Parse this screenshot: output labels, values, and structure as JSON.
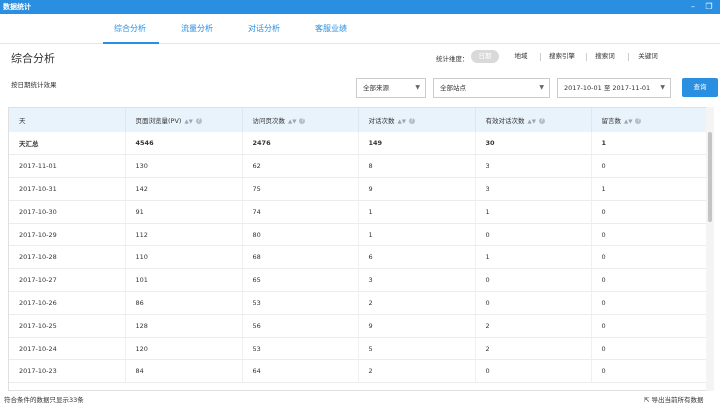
{
  "window": {
    "title": "数据统计",
    "minimize_icon": "minimize-icon",
    "restore_icon": "restore-icon"
  },
  "tabs": [
    {
      "label": "综合分析",
      "active": true
    },
    {
      "label": "流量分析",
      "active": false
    },
    {
      "label": "对话分析",
      "active": false
    },
    {
      "label": "客服业绩",
      "active": false
    }
  ],
  "page": {
    "title": "综合分析",
    "subtitle": "按日期统计效果"
  },
  "dimension": {
    "label": "统计维度：",
    "options": [
      "日期",
      "地域",
      "搜索引擎",
      "搜索词",
      "关键词"
    ],
    "active": "日期"
  },
  "filters": {
    "source": "全部来源",
    "site": "全部站点",
    "date_range": "2017-10-01 至 2017-11-01",
    "query_label": "查询"
  },
  "table": {
    "columns": [
      "天",
      "页面浏览量(PV)",
      "访问页次数",
      "对话次数",
      "有效对话次数",
      "留言数"
    ],
    "summary": [
      "天汇总",
      "4546",
      "2476",
      "149",
      "30",
      "1"
    ],
    "rows": [
      [
        "2017-11-01",
        "130",
        "62",
        "8",
        "3",
        "0"
      ],
      [
        "2017-10-31",
        "142",
        "75",
        "9",
        "3",
        "1"
      ],
      [
        "2017-10-30",
        "91",
        "74",
        "1",
        "1",
        "0"
      ],
      [
        "2017-10-29",
        "112",
        "80",
        "1",
        "0",
        "0"
      ],
      [
        "2017-10-28",
        "110",
        "68",
        "6",
        "1",
        "0"
      ],
      [
        "2017-10-27",
        "101",
        "65",
        "3",
        "0",
        "0"
      ],
      [
        "2017-10-26",
        "86",
        "53",
        "2",
        "0",
        "0"
      ],
      [
        "2017-10-25",
        "128",
        "56",
        "9",
        "2",
        "0"
      ],
      [
        "2017-10-24",
        "120",
        "53",
        "5",
        "2",
        "0"
      ],
      [
        "2017-10-23",
        "84",
        "64",
        "2",
        "0",
        "0"
      ]
    ]
  },
  "footer": {
    "count_text": "符合条件的数据只显示33条",
    "export_label": "导出当前所有数据"
  },
  "colors": {
    "accent": "#2a8fe0",
    "header_bg": "#e8f3fc"
  }
}
